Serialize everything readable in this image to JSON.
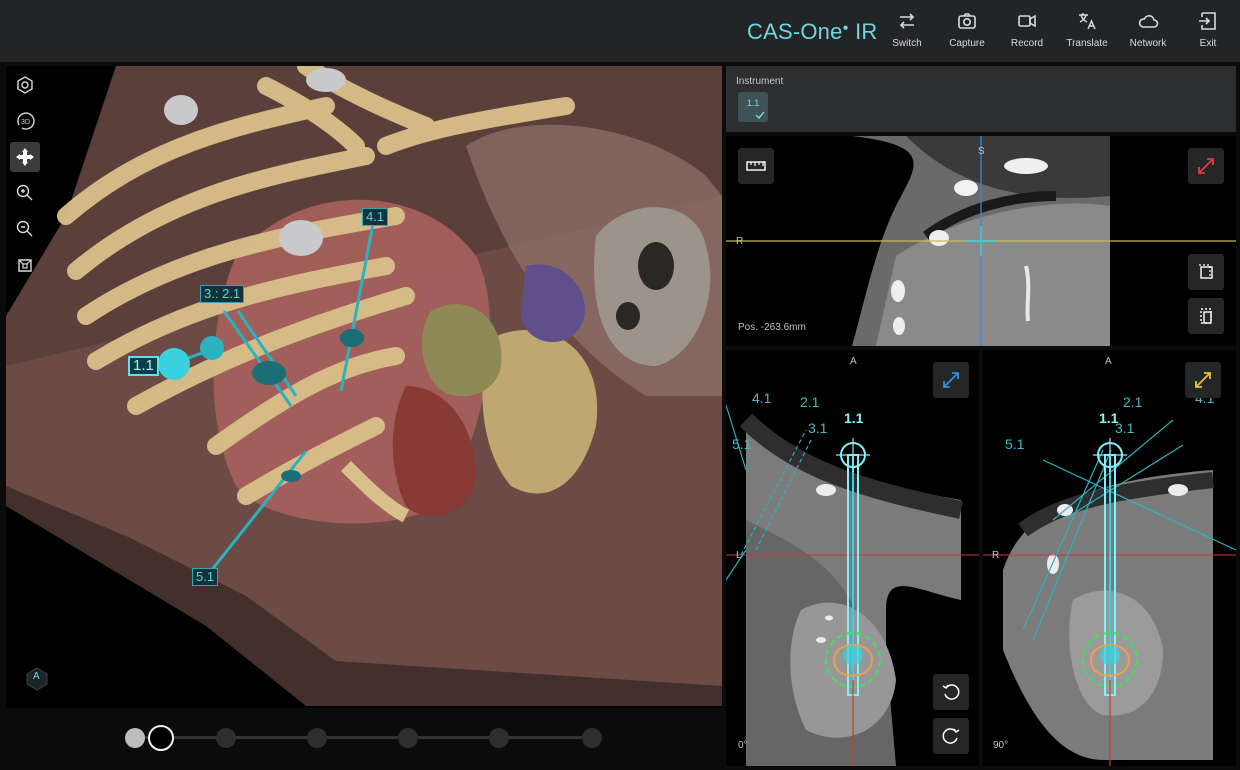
{
  "app": {
    "name": "CAS-One",
    "name_suffix": "IR"
  },
  "toolbar": [
    {
      "id": "switch",
      "label": "Switch",
      "icon": "switch-icon"
    },
    {
      "id": "capture",
      "label": "Capture",
      "icon": "camera-icon"
    },
    {
      "id": "record",
      "label": "Record",
      "icon": "video-icon"
    },
    {
      "id": "translate",
      "label": "Translate",
      "icon": "translate-icon"
    },
    {
      "id": "network",
      "label": "Network",
      "icon": "cloud-icon"
    },
    {
      "id": "exit",
      "label": "Exit",
      "icon": "exit-icon"
    }
  ],
  "view3d": {
    "tools": [
      "reset-view-icon",
      "3d-rotate-icon",
      "pan-icon",
      "zoom-in-icon",
      "zoom-out-icon",
      "orientation-icon"
    ],
    "active_tool": "pan-icon",
    "needle_labels": {
      "n11": "1.1",
      "n31_21": "3.: 2.1",
      "n41": "4.1",
      "n51": "5.1"
    },
    "orientation_cube_label": "A"
  },
  "timeline": {
    "steps": 7,
    "current": 1
  },
  "instrument": {
    "title": "Instrument",
    "selected": "1.1"
  },
  "views": {
    "top": {
      "orient_top": "S",
      "orient_left": "R",
      "position": "Pos. -263.6mm"
    },
    "bottom_left": {
      "orient_top": "A",
      "orient_left": "L",
      "angle": "0°",
      "labels": {
        "a": "4.1",
        "b": "2.1",
        "c": "3.1",
        "d": "5.1",
        "e": "1.1"
      }
    },
    "bottom_right": {
      "orient_top": "A",
      "orient_left": "R",
      "angle": "90°",
      "labels": {
        "a": "4.1",
        "b": "2.1",
        "c": "3.1",
        "d": "5.1",
        "e": "1.1"
      }
    }
  },
  "colors": {
    "accent": "#6fd7e4",
    "needle": "#2ab3bf",
    "ablation_zone": "#3ee35a",
    "expand_red": "#e0403b",
    "expand_blue": "#2d8fe0",
    "expand_yellow": "#e5c52b"
  }
}
